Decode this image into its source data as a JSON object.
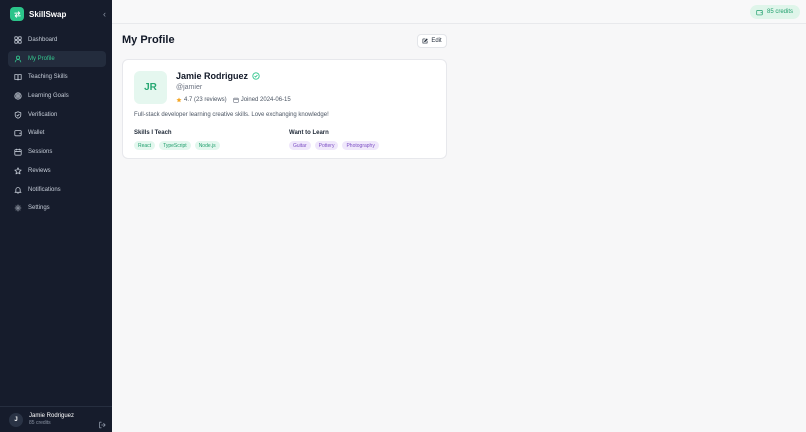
{
  "app": {
    "name": "SkillSwap",
    "collapse_glyph": "‹"
  },
  "sidebar": {
    "items": [
      {
        "label": "Dashboard",
        "icon": "grid-icon"
      },
      {
        "label": "My Profile",
        "icon": "user-icon",
        "active": true
      },
      {
        "label": "Teaching Skills",
        "icon": "book-icon"
      },
      {
        "label": "Learning Goals",
        "icon": "target-icon"
      },
      {
        "label": "Verification",
        "icon": "shield-check-icon"
      },
      {
        "label": "Wallet",
        "icon": "wallet-icon"
      },
      {
        "label": "Sessions",
        "icon": "calendar-icon"
      },
      {
        "label": "Reviews",
        "icon": "star-icon"
      },
      {
        "label": "Notifications",
        "icon": "bell-icon"
      },
      {
        "label": "Settings",
        "icon": "gear-icon"
      }
    ],
    "user": {
      "initial": "J",
      "name": "Jamie Rodriguez",
      "credits": "85 credits"
    }
  },
  "topbar": {
    "credits": "85 credits"
  },
  "main": {
    "title": "My Profile",
    "edit_label": "Edit",
    "profile": {
      "initials": "JR",
      "name": "Jamie Rodriguez",
      "handle": "@jamier",
      "rating": "4.7 (23 reviews)",
      "joined": "Joined 2024-06-15",
      "bio": "Full-stack developer learning creative skills. Love exchanging knowledge!",
      "teach_label": "Skills I Teach",
      "teach": [
        "React",
        "TypeScript",
        "Node.js"
      ],
      "learn_label": "Want to Learn",
      "learn": [
        "Guitar",
        "Pottery",
        "Photography"
      ]
    }
  },
  "colors": {
    "accent": "#2bc48a",
    "sidebar_bg": "#161c2c",
    "teach_tag": "#1f9e6c",
    "learn_tag": "#7c4fc4",
    "star": "#f5a623"
  }
}
